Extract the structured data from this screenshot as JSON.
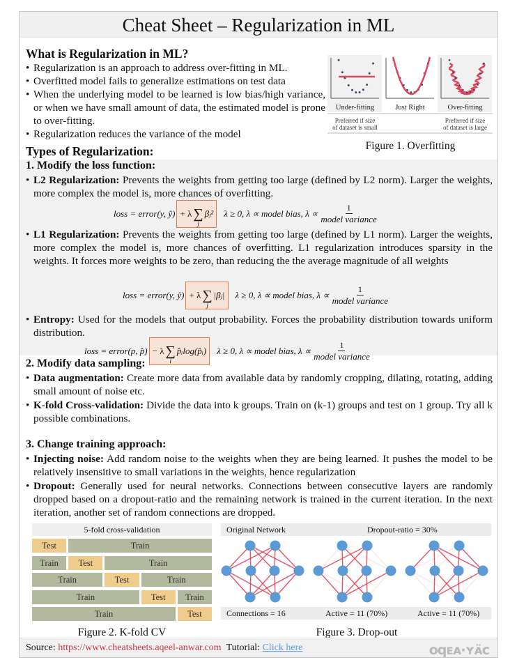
{
  "title": "Cheat Sheet – Regularization in ML",
  "what_is": {
    "heading": "What is Regularization in ML?",
    "bullets": [
      "Regularization is an approach to address over-fitting in ML.",
      "Overfitted model fails to generalize estimations on test data",
      "When the underlying model to be learned is low bias/high variance, or when we have small amount of data, the estimated model is prone to over-fitting.",
      "Regularization reduces the variance of the model"
    ]
  },
  "figure1": {
    "caption": "Figure 1. Overfitting",
    "panels": [
      {
        "label": "Under-fitting",
        "note": "Preferred if size of dataset is small"
      },
      {
        "label": "Just Right",
        "note": ""
      },
      {
        "label": "Over-fitting",
        "note": "Preferred if size of dataset is large"
      }
    ],
    "fit_color": "#e0445a",
    "point_color": "#3a4a66"
  },
  "types_heading": "Types of Regularization:",
  "section1": {
    "heading": "1. Modify the loss function:",
    "items": [
      {
        "term": "L2 Regularization:",
        "text": "Prevents the weights from getting too large (defined by L2 norm). Larger the weights, more complex the model is, more chances of overfitting.",
        "formula": {
          "lhs": "loss = error(y, ŷ)",
          "highlight_op": "+ λ",
          "highlight_term": "βⱼ²",
          "sum_index": "j",
          "conditions": "λ ≥ 0,  λ ∝ model bias,  λ ∝",
          "frac_num": "1",
          "frac_den": "model variance"
        }
      },
      {
        "term": "L1 Regularization:",
        "text": "Prevents the weights from getting too large (defined by L1 norm). Larger the weights, more complex the model is, more chances of overfitting. L1 regularization introduces sparsity in the weights. It forces more weights to be zero, than reducing the the average magnitude of all weights",
        "formula": {
          "lhs": "loss = error(y, ŷ)",
          "highlight_op": "+ λ",
          "highlight_term": "|βⱼ|",
          "sum_index": "j",
          "conditions": "λ ≥ 0,  λ ∝ model bias,  λ ∝",
          "frac_num": "1",
          "frac_den": "model variance"
        }
      },
      {
        "term": "Entropy:",
        "text": "Used for the models that output probability. Forces the probability distribution towards uniform distribution.",
        "formula": {
          "lhs": "loss = error(p, p̂)",
          "highlight_op": "− λ",
          "highlight_term": "p̂ᵢlog(p̂ᵢ)",
          "sum_index": "i",
          "conditions": "λ ≥ 0,  λ ∝ model bias,  λ ∝",
          "frac_num": "1",
          "frac_den": "model variance"
        }
      }
    ]
  },
  "section2": {
    "heading": "2. Modify data sampling:",
    "items": [
      {
        "term": "Data augmentation:",
        "text": "Create more data from available data by randomly cropping, dilating, rotating, adding small amount of noise etc."
      },
      {
        "term": "K-fold Cross-validation:",
        "text": "Divide the data into k groups. Train on (k-1) groups and test on 1 group. Try all k possible combinations."
      }
    ]
  },
  "section3": {
    "heading": "3. Change training approach:",
    "items": [
      {
        "term": "Injecting noise:",
        "text": "Add random noise to the weights when they are being learned. It pushes the model to be relatively insensitive to small variations in the weights, hence regularization"
      },
      {
        "term": "Dropout:",
        "text": "Generally used for neural networks. Connections between consecutive layers are randomly dropped based on a dropout-ratio and the remaining network is trained in the current iteration. In the next iteration, another set of random connections are dropped."
      }
    ]
  },
  "figure2": {
    "caption": "Figure 2. K-fold CV",
    "header": "5-fold cross-validation",
    "train_label": "Train",
    "test_label": "Test",
    "folds": 5,
    "train_color": "#b3b99e",
    "test_color": "#f0cc8c"
  },
  "figure3": {
    "caption": "Figure 3. Drop-out",
    "original_label": "Original Network",
    "dropout_label": "Dropout-ratio = 30%",
    "dropout_ratio": 0.3,
    "stats": [
      "Connections = 16",
      "Active = 11 (70%)",
      "Active = 11 (70%)"
    ],
    "node_color": "#5b9bd5",
    "edge_color": "#e0445a"
  },
  "footer": {
    "source_label": "Source:",
    "source_url": "https://www.cheatsheets.aqeel-anwar.com",
    "tutorial_label": "Tutorial:",
    "tutorial_link": "Click here",
    "logo_text": "aqeel·anwar"
  }
}
